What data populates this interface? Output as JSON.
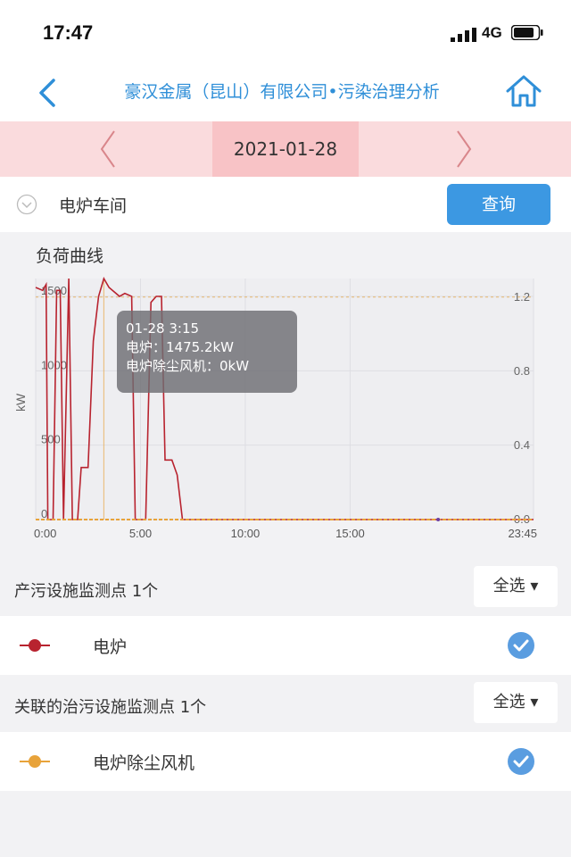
{
  "status_bar": {
    "time": "17:47",
    "network": "4G"
  },
  "header": {
    "title": "豪汉金属（昆山）有限公司•污染治理分析"
  },
  "date_nav": {
    "date": "2021-01-28"
  },
  "filter": {
    "workshop": "电炉车间",
    "query_label": "查询"
  },
  "chart_section": {
    "title": "负荷曲线",
    "tooltip": {
      "time": "01-28 3:15",
      "line1": "电炉：1475.2kW",
      "line2": "电炉除尘风机：0kW"
    }
  },
  "chart_data": {
    "type": "line",
    "ylabel": "kW",
    "x_ticks": [
      "0:00",
      "5:00",
      "10:00",
      "15:00",
      "23:45"
    ],
    "y_left_ticks": [
      "0",
      "500",
      "1000",
      "1500"
    ],
    "y_right_ticks": [
      "0.0",
      "0.4",
      "0.8",
      "1.2"
    ],
    "ylim_left": [
      0,
      1620
    ],
    "ylim_right": [
      0,
      1.3
    ],
    "series": [
      {
        "name": "电炉",
        "color": "#b8232f",
        "axis": "left",
        "points": [
          [
            0.0,
            1560
          ],
          [
            0.33,
            1540
          ],
          [
            0.5,
            1580
          ],
          [
            0.58,
            0
          ],
          [
            0.83,
            0
          ],
          [
            1.0,
            1540
          ],
          [
            1.17,
            1540
          ],
          [
            1.33,
            0
          ],
          [
            1.58,
            1620
          ],
          [
            1.75,
            0
          ],
          [
            2.0,
            0
          ],
          [
            2.17,
            350
          ],
          [
            2.5,
            350
          ],
          [
            2.75,
            1200
          ],
          [
            3.0,
            1500
          ],
          [
            3.25,
            1620
          ],
          [
            3.5,
            1560
          ],
          [
            4.0,
            1500
          ],
          [
            4.25,
            1520
          ],
          [
            4.58,
            1500
          ],
          [
            4.75,
            0
          ],
          [
            5.0,
            0
          ],
          [
            5.25,
            0
          ],
          [
            5.5,
            1460
          ],
          [
            5.75,
            1500
          ],
          [
            6.0,
            1500
          ],
          [
            6.17,
            400
          ],
          [
            6.5,
            400
          ],
          [
            6.75,
            300
          ],
          [
            7.0,
            0
          ],
          [
            23.75,
            0
          ]
        ]
      },
      {
        "name": "电炉除尘风机",
        "color": "#e8a33a",
        "axis": "right",
        "points": [
          [
            0.0,
            0
          ],
          [
            23.75,
            0
          ]
        ]
      }
    ]
  },
  "polluting_section": {
    "label": "产污设施监测点 1个",
    "select_all": "全选"
  },
  "polluting_items": [
    {
      "name": "电炉",
      "color": "#b8232f",
      "checked": true
    }
  ],
  "control_section": {
    "label": "关联的治污设施监测点 1个",
    "select_all": "全选"
  },
  "control_items": [
    {
      "name": "电炉除尘风机",
      "color": "#e8a33a",
      "checked": true
    }
  ],
  "colors": {
    "accent": "#3c98e2",
    "title": "#2f8fd8",
    "date_bar": "#fadbdd",
    "date_active": "#f8c3c6"
  },
  "icons": [
    "back-icon",
    "home-icon",
    "chevron-left-icon",
    "chevron-right-icon",
    "chevron-down-icon",
    "check-icon"
  ]
}
